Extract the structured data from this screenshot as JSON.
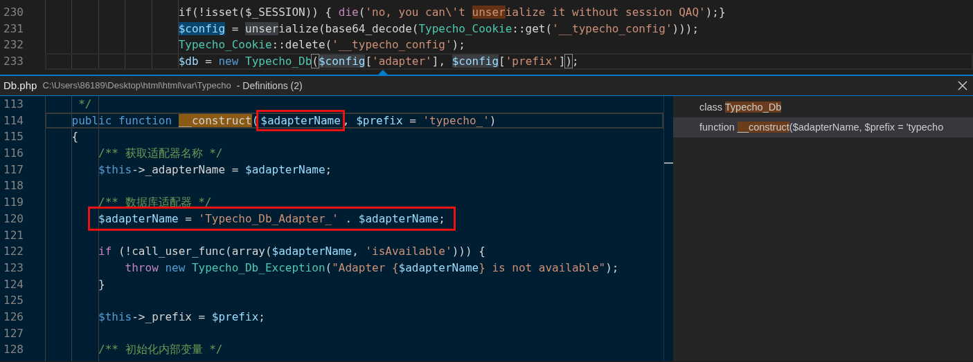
{
  "editor": {
    "lines": [
      {
        "number": "230",
        "current": false,
        "tokens": [
          {
            "t": "                    if(!isset($_SESSION)) { ",
            "kind": "plain"
          },
          {
            "t": "die",
            "kind": "control"
          },
          {
            "t": "(",
            "kind": "plain"
          },
          {
            "t": "'no, you can\\'t ",
            "kind": "string"
          },
          {
            "t": "unser",
            "kind": "string-match"
          },
          {
            "t": "ialize it without session QAQ'",
            "kind": "string"
          },
          {
            "t": ");}",
            "kind": "plain"
          }
        ]
      },
      {
        "number": "231",
        "current": false,
        "tokens": [
          {
            "t": "                    $config",
            "kind": "var-ref"
          },
          {
            "t": " = ",
            "kind": "plain"
          },
          {
            "t": "unser",
            "kind": "plain-word"
          },
          {
            "t": "ialize(base64_decode(",
            "kind": "plain"
          },
          {
            "t": "Typecho_Cookie",
            "kind": "type"
          },
          {
            "t": "::get(",
            "kind": "plain"
          },
          {
            "t": "'__typecho_config'",
            "kind": "string"
          },
          {
            "t": ")));",
            "kind": "plain"
          }
        ]
      },
      {
        "number": "232",
        "current": false,
        "tokens": [
          {
            "t": "                    Typecho_Cookie",
            "kind": "type"
          },
          {
            "t": "::delete(",
            "kind": "plain"
          },
          {
            "t": "'__typecho_config'",
            "kind": "string"
          },
          {
            "t": ");",
            "kind": "plain"
          }
        ]
      },
      {
        "number": "233",
        "current": true,
        "tokens": [
          {
            "t": "                    $db",
            "kind": "var"
          },
          {
            "t": " = ",
            "kind": "plain"
          },
          {
            "t": "new ",
            "kind": "keyword"
          },
          {
            "t": "Typecho_Db",
            "kind": "type"
          },
          {
            "t": "(",
            "kind": "plain-bracket"
          },
          {
            "t": "$config",
            "kind": "var-word"
          },
          {
            "t": "[",
            "kind": "plain"
          },
          {
            "t": "'adapter'",
            "kind": "string"
          },
          {
            "t": "], ",
            "kind": "plain"
          },
          {
            "t": "$config",
            "kind": "var-word"
          },
          {
            "t": "[",
            "kind": "plain"
          },
          {
            "t": "'prefix'",
            "kind": "string"
          },
          {
            "t": "]",
            "kind": "plain"
          },
          {
            "t": ")",
            "kind": "plain-bracket"
          },
          {
            "t": ";",
            "kind": "plain"
          }
        ]
      }
    ]
  },
  "peek": {
    "file": "Db.php",
    "path": "C:\\Users\\86189\\Desktop\\html\\html\\var\\Typecho",
    "title": "- Definitions (2)",
    "lines": [
      {
        "number": "113",
        "current": false,
        "tokens": [
          {
            "t": "     */",
            "kind": "comment"
          }
        ]
      },
      {
        "number": "114",
        "current": true,
        "tokens": [
          {
            "t": "    public function ",
            "kind": "keyword"
          },
          {
            "t": "__construct",
            "kind": "plain-def"
          },
          {
            "t": "(",
            "kind": "plain"
          },
          {
            "t": "$adapterName",
            "kind": "var",
            "boxed": true
          },
          {
            "t": ", ",
            "kind": "plain"
          },
          {
            "t": "$prefix",
            "kind": "var"
          },
          {
            "t": " = ",
            "kind": "plain"
          },
          {
            "t": "'typecho_'",
            "kind": "string"
          },
          {
            "t": ")",
            "kind": "plain"
          }
        ]
      },
      {
        "number": "115",
        "current": false,
        "tokens": [
          {
            "t": "    {",
            "kind": "plain"
          }
        ]
      },
      {
        "number": "116",
        "current": false,
        "tokens": [
          {
            "t": "        /** 获取适配器名称 */",
            "kind": "comment"
          }
        ]
      },
      {
        "number": "117",
        "current": false,
        "tokens": [
          {
            "t": "        $this",
            "kind": "keyword"
          },
          {
            "t": "->_adapterName = ",
            "kind": "plain"
          },
          {
            "t": "$adapterName",
            "kind": "var"
          },
          {
            "t": ";",
            "kind": "plain"
          }
        ]
      },
      {
        "number": "118",
        "current": false
      },
      {
        "number": "119",
        "current": false,
        "tokens": [
          {
            "t": "        /** 数据库适配器 */",
            "kind": "comment"
          }
        ]
      },
      {
        "number": "120",
        "current": false,
        "boxed": true,
        "tokens": [
          {
            "t": "$adapterName",
            "kind": "var"
          },
          {
            "t": " = ",
            "kind": "plain"
          },
          {
            "t": "'Typecho_Db_Adapter_'",
            "kind": "string"
          },
          {
            "t": " . ",
            "kind": "plain"
          },
          {
            "t": "$adapterName",
            "kind": "var"
          },
          {
            "t": ";",
            "kind": "plain"
          }
        ]
      },
      {
        "number": "121",
        "current": false
      },
      {
        "number": "122",
        "current": false,
        "tokens": [
          {
            "t": "        if",
            "kind": "control"
          },
          {
            "t": " (!call_user_func(array(",
            "kind": "plain"
          },
          {
            "t": "$adapterName",
            "kind": "var"
          },
          {
            "t": ", ",
            "kind": "plain"
          },
          {
            "t": "'isAvailable'",
            "kind": "string"
          },
          {
            "t": "))) {",
            "kind": "plain"
          }
        ]
      },
      {
        "number": "123",
        "current": false,
        "tokens": [
          {
            "t": "            throw ",
            "kind": "control"
          },
          {
            "t": "new ",
            "kind": "keyword"
          },
          {
            "t": "Typecho_Db_Exception",
            "kind": "type"
          },
          {
            "t": "(",
            "kind": "plain"
          },
          {
            "t": "\"Adapter {",
            "kind": "string"
          },
          {
            "t": "$adapterName",
            "kind": "var"
          },
          {
            "t": "} is not available\"",
            "kind": "string"
          },
          {
            "t": ");",
            "kind": "plain"
          }
        ]
      },
      {
        "number": "124",
        "current": false,
        "tokens": [
          {
            "t": "        }",
            "kind": "plain"
          }
        ]
      },
      {
        "number": "125",
        "current": false
      },
      {
        "number": "126",
        "current": false,
        "tokens": [
          {
            "t": "        $this",
            "kind": "keyword"
          },
          {
            "t": "->_prefix = ",
            "kind": "plain"
          },
          {
            "t": "$prefix",
            "kind": "var"
          },
          {
            "t": ";",
            "kind": "plain"
          }
        ]
      },
      {
        "number": "127",
        "current": false
      },
      {
        "number": "128",
        "current": false,
        "tokens": [
          {
            "t": "        /** 初始化内部变量 */",
            "kind": "comment"
          }
        ]
      }
    ],
    "references": [
      {
        "selected": false,
        "parts": [
          {
            "t": "class ",
            "kind": "plain"
          },
          {
            "t": "Typecho_Db",
            "kind": "match"
          }
        ]
      },
      {
        "selected": true,
        "parts": [
          {
            "t": "function ",
            "kind": "plain"
          },
          {
            "t": "__construct",
            "kind": "match"
          },
          {
            "t": "($adapterName, $prefix = 'typecho",
            "kind": "plain"
          }
        ]
      }
    ]
  }
}
